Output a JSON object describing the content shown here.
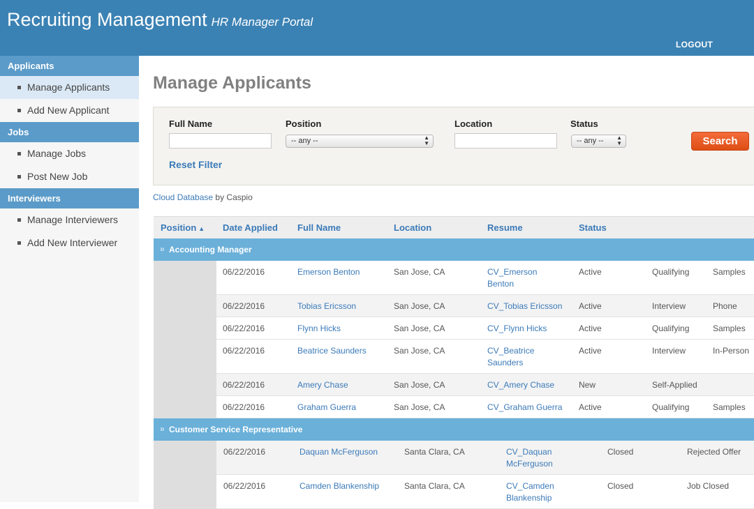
{
  "header": {
    "title": "Recruiting Management",
    "subtitle": "HR Manager Portal",
    "logout": "LOGOUT"
  },
  "sidebar": {
    "sections": [
      {
        "label": "Applicants",
        "items": [
          "Manage Applicants",
          "Add New Applicant"
        ]
      },
      {
        "label": "Jobs",
        "items": [
          "Manage Jobs",
          "Post New Job"
        ]
      },
      {
        "label": "Interviewers",
        "items": [
          "Manage Interviewers",
          "Add New Interviewer"
        ]
      }
    ],
    "active_item": "Manage Applicants"
  },
  "page": {
    "title": "Manage Applicants"
  },
  "filter": {
    "full_name_label": "Full Name",
    "full_name_value": "",
    "position_label": "Position",
    "position_value": "-- any --",
    "location_label": "Location",
    "location_value": "",
    "status_label": "Status",
    "status_value": "-- any --",
    "search_label": "Search",
    "reset_label": "Reset Filter"
  },
  "powered_by": {
    "link": "Cloud Database",
    "text": "by Caspio"
  },
  "table": {
    "columns": [
      "Position",
      "Date Applied",
      "Full Name",
      "Location",
      "Resume",
      "Status"
    ],
    "groups": [
      {
        "position": "Accounting Manager",
        "rows": [
          {
            "date": "06/22/2016",
            "name": "Emerson Benton",
            "location": "San Jose, CA",
            "resume": [
              "CV_Emerson",
              "Benton"
            ],
            "status": "Active",
            "stage": "Qualifying",
            "extra": "Samples"
          },
          {
            "date": "06/22/2016",
            "name": "Tobias Ericsson",
            "location": "San Jose, CA",
            "resume": [
              "CV_Tobias Ericsson"
            ],
            "status": "Active",
            "stage": "Interview",
            "extra": "Phone"
          },
          {
            "date": "06/22/2016",
            "name": "Flynn Hicks",
            "location": "San Jose, CA",
            "resume": [
              "CV_Flynn Hicks"
            ],
            "status": "Active",
            "stage": "Qualifying",
            "extra": "Samples"
          },
          {
            "date": "06/22/2016",
            "name": "Beatrice Saunders",
            "location": "San Jose, CA",
            "resume": [
              "CV_Beatrice",
              "Saunders"
            ],
            "status": "Active",
            "stage": "Interview",
            "extra": "In-Person"
          },
          {
            "date": "06/22/2016",
            "name": "Amery Chase",
            "location": "San Jose, CA",
            "resume": [
              "CV_Amery Chase"
            ],
            "status": "New",
            "stage": "Self-Applied",
            "extra": ""
          },
          {
            "date": "06/22/2016",
            "name": "Graham Guerra",
            "location": "San Jose, CA",
            "resume": [
              "CV_Graham Guerra"
            ],
            "status": "Active",
            "stage": "Qualifying",
            "extra": "Samples"
          }
        ]
      },
      {
        "position": "Customer Service Representative",
        "rows": [
          {
            "date": "06/22/2016",
            "name": "Daquan McFerguson",
            "location": "Santa Clara, CA",
            "resume": [
              "CV_Daquan",
              "McFerguson"
            ],
            "status": "Closed",
            "stage": "Rejected Offer",
            "extra": ""
          },
          {
            "date": "06/22/2016",
            "name": "Camden Blankenship",
            "location": "Santa Clara, CA",
            "resume": [
              "CV_Camden",
              "Blankenship"
            ],
            "status": "Closed",
            "stage": "Job Closed",
            "extra": ""
          }
        ]
      }
    ]
  },
  "colors": {
    "header_bg": "#3b82b4",
    "sidebar_section_bg": "#5b9bc9",
    "group_bg": "#6ab0d9",
    "link": "#3b7ab8",
    "search_button": "#e85a22"
  }
}
